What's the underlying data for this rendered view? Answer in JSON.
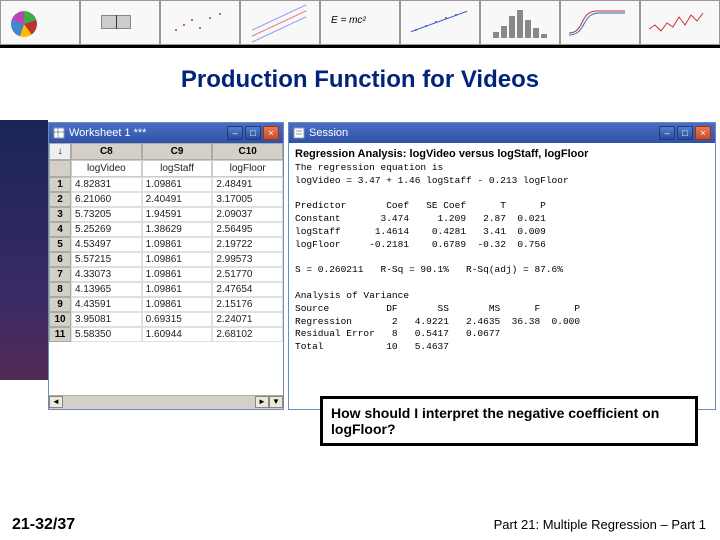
{
  "thumbnails": {
    "formula": "E = mc²"
  },
  "title": "Production Function for Videos",
  "worksheet": {
    "window_title": "Worksheet 1 ***",
    "headers": [
      "C8",
      "C9",
      "C10"
    ],
    "names": [
      "logVideo",
      "logStaff",
      "logFloor"
    ],
    "rows": [
      [
        "1",
        "4.82831",
        "1.09861",
        "2.48491"
      ],
      [
        "2",
        "6.21060",
        "2.40491",
        "3.17005"
      ],
      [
        "3",
        "5.73205",
        "1.94591",
        "2.09037"
      ],
      [
        "4",
        "5.25269",
        "1.38629",
        "2.56495"
      ],
      [
        "5",
        "4.53497",
        "1.09861",
        "2.19722"
      ],
      [
        "6",
        "5.57215",
        "1.09861",
        "2.99573"
      ],
      [
        "7",
        "4.33073",
        "1.09861",
        "2.51770"
      ],
      [
        "8",
        "4.13965",
        "1.09861",
        "2.47654"
      ],
      [
        "9",
        "4.43591",
        "1.09861",
        "2.15176"
      ],
      [
        "10",
        "3.95081",
        "0.69315",
        "2.24071"
      ],
      [
        "11",
        "5.58350",
        "1.60944",
        "2.68102"
      ]
    ]
  },
  "session": {
    "window_title": "Session",
    "heading": "Regression Analysis: logVideo versus logStaff, logFloor",
    "eq1": "The regression equation is",
    "eq2": "logVideo = 3.47 + 1.46 logStaff - 0.213 logFloor",
    "pred_head": "Predictor       Coef   SE Coef      T      P",
    "pred1": "Constant       3.474     1.209   2.87  0.021",
    "pred2": "logStaff      1.4614    0.4281   3.41  0.009",
    "pred3": "logFloor     -0.2181    0.6789  -0.32  0.756",
    "sline": "S = 0.260211   R-Sq = 90.1%   R-Sq(adj) = 87.6%",
    "aov_head": "Analysis of Variance",
    "aov_cols": "Source          DF       SS       MS      F      P",
    "aov1": "Regression       2   4.9221   2.4635  36.38  0.000",
    "aov2": "Residual Error   8   0.5417   0.0677",
    "aov3": "Total           10   5.4637"
  },
  "callout": "How should I interpret the negative coefficient on logFloor?",
  "footer": {
    "left": "21-32/37",
    "right": "Part 21: Multiple Regression – Part 1"
  },
  "chart_data": {
    "type": "table",
    "title": "Regression Analysis: logVideo versus logStaff, logFloor",
    "equation": "logVideo = 3.47 + 1.46 logStaff - 0.213 logFloor",
    "coefficients": {
      "columns": [
        "Predictor",
        "Coef",
        "SE Coef",
        "T",
        "P"
      ],
      "rows": [
        [
          "Constant",
          3.474,
          1.209,
          2.87,
          0.021
        ],
        [
          "logStaff",
          1.4614,
          0.4281,
          3.41,
          0.009
        ],
        [
          "logFloor",
          -0.2181,
          0.6789,
          -0.32,
          0.756
        ]
      ]
    },
    "fit": {
      "S": 0.260211,
      "R-Sq": "90.1%",
      "R-Sq(adj)": "87.6%"
    },
    "anova": {
      "columns": [
        "Source",
        "DF",
        "SS",
        "MS",
        "F",
        "P"
      ],
      "rows": [
        [
          "Regression",
          2,
          4.9221,
          2.4635,
          36.38,
          0.0
        ],
        [
          "Residual Error",
          8,
          0.5417,
          0.0677,
          null,
          null
        ],
        [
          "Total",
          10,
          5.4637,
          null,
          null,
          null
        ]
      ]
    },
    "worksheet_data": {
      "columns": [
        "logVideo",
        "logStaff",
        "logFloor"
      ],
      "values": [
        [
          4.82831,
          1.09861,
          2.48491
        ],
        [
          6.2106,
          2.40491,
          3.17005
        ],
        [
          5.73205,
          1.94591,
          2.09037
        ],
        [
          5.25269,
          1.38629,
          2.56495
        ],
        [
          4.53497,
          1.09861,
          2.19722
        ],
        [
          5.57215,
          1.09861,
          2.99573
        ],
        [
          4.33073,
          1.09861,
          2.5177
        ],
        [
          4.13965,
          1.09861,
          2.47654
        ],
        [
          4.43591,
          1.09861,
          2.15176
        ],
        [
          3.95081,
          0.69315,
          2.24071
        ],
        [
          5.5835,
          1.60944,
          2.68102
        ]
      ]
    }
  }
}
